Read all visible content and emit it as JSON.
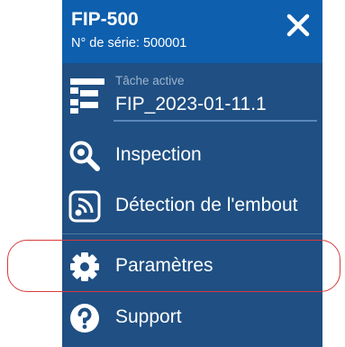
{
  "header": {
    "device_name": "FIP-500",
    "serial": "N° de série: 500001"
  },
  "task": {
    "caption": "Tâche active",
    "value": "FIP_2023-01-11.1"
  },
  "menu": [
    {
      "label": "Inspection",
      "icon": "magnifier-icon"
    },
    {
      "label": "Détection de l'embout",
      "icon": "tip-detection-icon"
    },
    {
      "label": "Paramètres",
      "icon": "gear-icon"
    },
    {
      "label": "Support",
      "icon": "help-icon"
    }
  ],
  "colors": {
    "header": "#0e5fae",
    "panel": "#1f4f83",
    "highlight_outline": "#d63b3b"
  }
}
